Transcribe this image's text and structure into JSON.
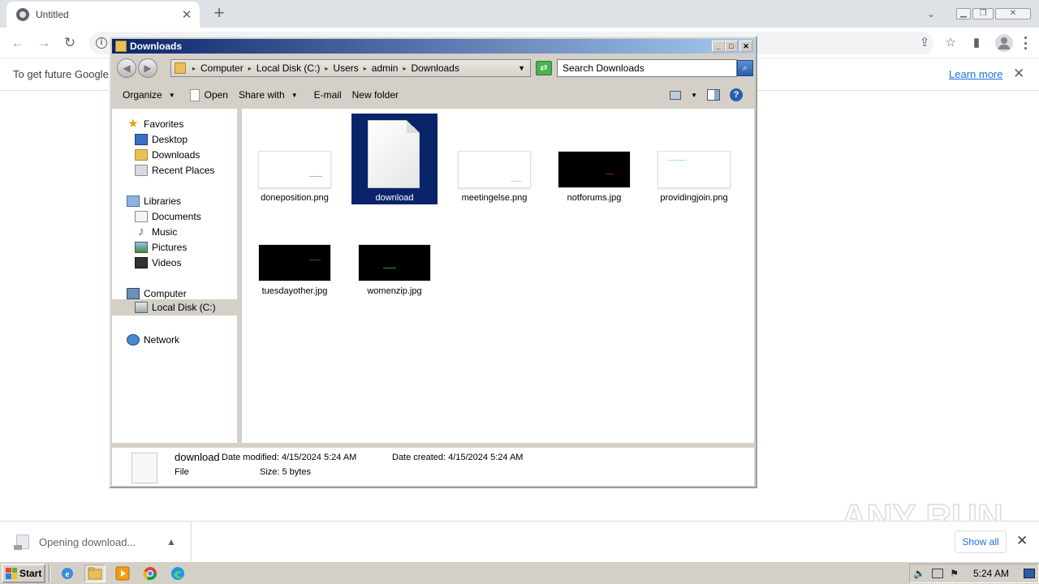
{
  "browser": {
    "tab_title": "Untitled",
    "infobar_message": "To get future Google",
    "learn_more": "Learn more",
    "download_status": "Opening download...",
    "show_all": "Show all",
    "watermark": "ANY RUN"
  },
  "window": {
    "title": "Downloads",
    "breadcrumb": [
      "Computer",
      "Local Disk (C:)",
      "Users",
      "admin",
      "Downloads"
    ],
    "search_placeholder": "Search Downloads",
    "commands": {
      "organize": "Organize",
      "open": "Open",
      "share_with": "Share with",
      "email": "E-mail",
      "new_folder": "New folder"
    }
  },
  "nav": {
    "favorites": "Favorites",
    "desktop": "Desktop",
    "downloads": "Downloads",
    "recent_places": "Recent Places",
    "libraries": "Libraries",
    "documents": "Documents",
    "music": "Music",
    "pictures": "Pictures",
    "videos": "Videos",
    "computer": "Computer",
    "local_disk": "Local Disk (C:)",
    "network": "Network"
  },
  "files": [
    {
      "name": "doneposition.png",
      "thumb": "white",
      "mark": "#bdbdbd"
    },
    {
      "name": "download",
      "thumb": "document",
      "selected": true
    },
    {
      "name": "meetingelse.png",
      "thumb": "white",
      "mark": "#f4c6d0"
    },
    {
      "name": "notforums.jpg",
      "thumb": "black",
      "mark": "#8a1a1a"
    },
    {
      "name": "providingjoin.png",
      "thumb": "white",
      "mark": "#9ee6f0"
    },
    {
      "name": "tuesdayother.jpg",
      "thumb": "black",
      "mark": "#1f5a1f"
    },
    {
      "name": "womenzip.jpg",
      "thumb": "black",
      "mark": "#2c9a2c"
    }
  ],
  "details": {
    "name": "download",
    "date_modified": "Date modified: 4/15/2024 5:24 AM",
    "date_created": "Date created: 4/15/2024 5:24 AM",
    "type": "File",
    "size": "Size: 5 bytes"
  },
  "taskbar": {
    "start": "Start",
    "clock": "5:24 AM"
  }
}
